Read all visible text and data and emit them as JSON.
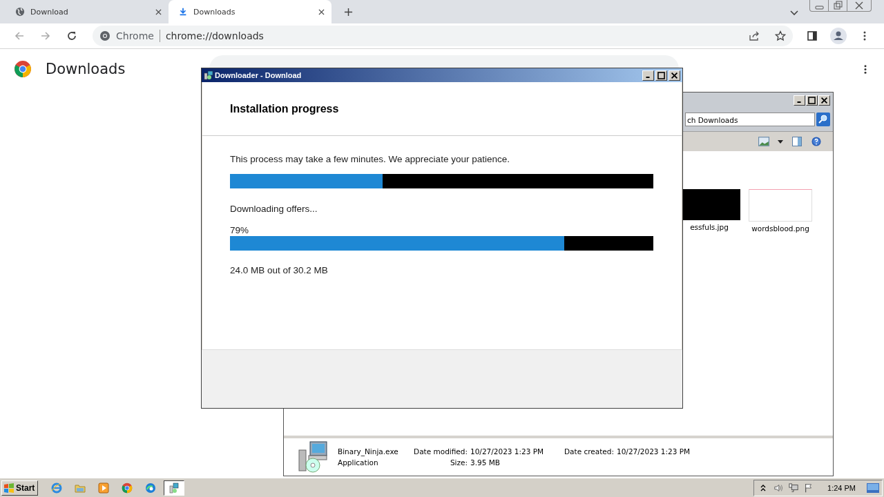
{
  "browser": {
    "tabs": [
      {
        "title": "Download",
        "selected": false
      },
      {
        "title": "Downloads",
        "selected": true
      }
    ],
    "omnibox": {
      "site_label": "Chrome",
      "url": "chrome://downloads"
    },
    "page": {
      "title": "Downloads"
    }
  },
  "explorer": {
    "search_value": "ch Downloads",
    "files": [
      {
        "name": "essfuls.jpg",
        "kind": "dark"
      },
      {
        "name": "wordsblood.png",
        "kind": "blank"
      }
    ],
    "details": {
      "name": "Binary_Ninja.exe",
      "type": "Application",
      "fields": [
        {
          "label": "Date modified:",
          "value": "10/27/2023 1:23 PM"
        },
        {
          "label": "Date created:",
          "value": "10/27/2023 1:23 PM"
        },
        {
          "label": "Size:",
          "value": "3.95 MB"
        }
      ]
    }
  },
  "dialog": {
    "title": "Downloader - Download",
    "heading": "Installation progress",
    "message": "This process may take a few minutes. We appreciate your patience.",
    "overall_progress": {
      "level": 0.36
    },
    "status": "Downloading offers...",
    "percent": "79%",
    "download_progress": {
      "level": 0.79
    },
    "size_text": "24.0 MB out of 30.2 MB"
  },
  "taskbar": {
    "start": "Start",
    "apps": [
      {
        "kind": "ie",
        "selected": false
      },
      {
        "kind": "folder",
        "selected": false
      },
      {
        "kind": "media",
        "selected": false
      },
      {
        "kind": "chrome",
        "selected": false
      },
      {
        "kind": "edge",
        "selected": false
      },
      {
        "kind": "installer",
        "selected": true
      }
    ],
    "clock": "1:24 PM"
  }
}
